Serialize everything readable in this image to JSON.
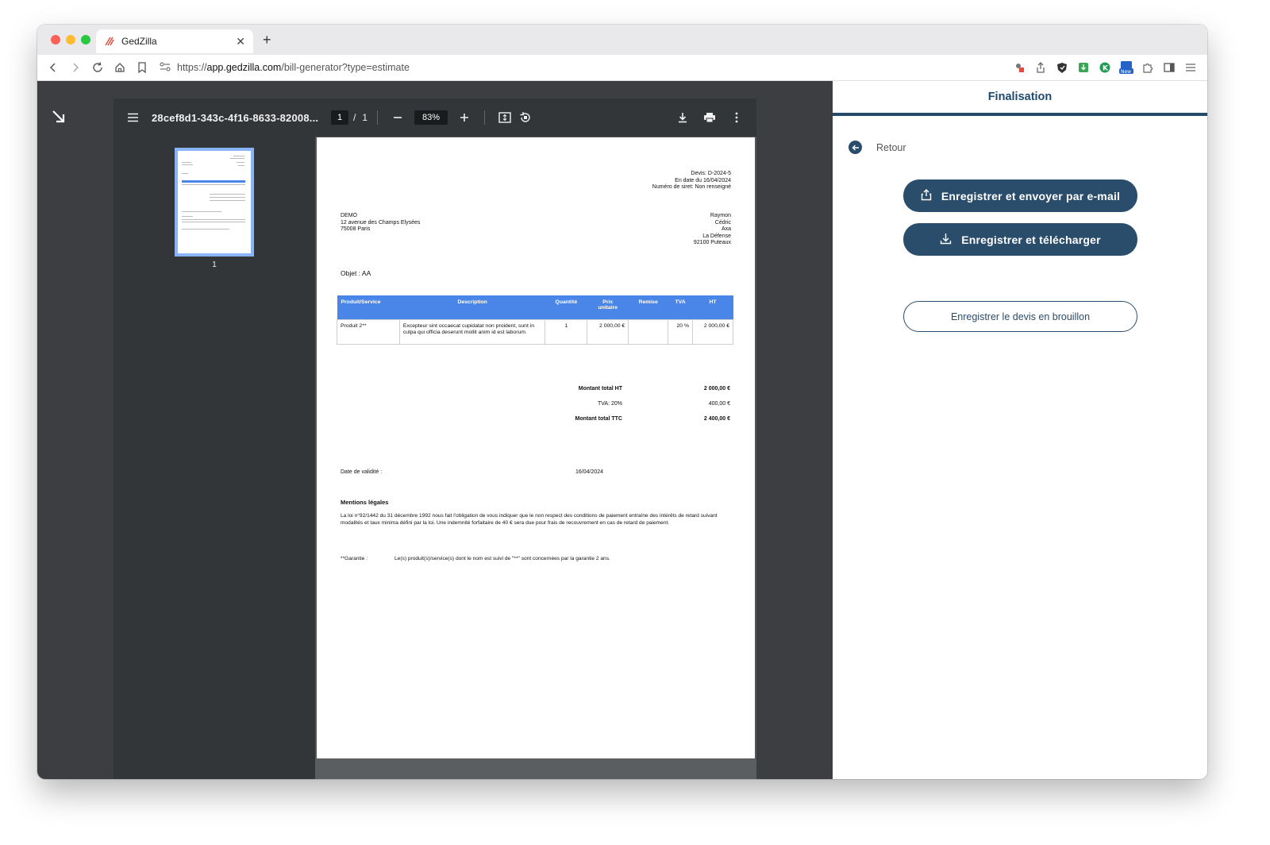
{
  "browser": {
    "tab_title": "GedZilla",
    "tab_close": "✕",
    "new_tab": "+",
    "url_scheme": "https://",
    "url_host": "app.gedzilla.com",
    "url_path": "/bill-generator?type=estimate"
  },
  "pdf_viewer": {
    "file_name": "28cef8d1-343c-4f16-8633-82008...",
    "current_page": "1",
    "page_separator": "/",
    "total_pages": "1",
    "zoom": "83%",
    "thumbnail_label": "1"
  },
  "document": {
    "devis_number": "Devis: D-2024-5",
    "date_line": "En date du 16/04/2024",
    "siret_line": "Numéro de siret: Non renseigné",
    "sender": {
      "name": "DEMO",
      "address": "12 avenue des Champs Elysées",
      "city": "75008 Paris"
    },
    "recipient": {
      "line1": "Raymon",
      "line2": "Cédric",
      "line3": "Axa",
      "line4": "La Défense",
      "line5": "92100 Puteaux"
    },
    "objet": "Objet : AA",
    "table": {
      "headers": {
        "product": "Produit/Service",
        "description": "Description",
        "quantity": "Quantité",
        "unit_price_1": "Prix",
        "unit_price_2": "unitaire",
        "discount": "Remise",
        "tva": "TVA",
        "ht": "HT"
      },
      "rows": [
        {
          "product": "Produit 2**",
          "description": "Excepteur sint occaecat cupidatat non proident, sunt in culpa qui officia deserunt mollit anim id est laborum.",
          "quantity": "1",
          "unit_price": "2 000,00 €",
          "discount": "",
          "tva": "20 %",
          "ht": "2 000,00 €"
        }
      ]
    },
    "totals": {
      "ht_label": "Montant total HT",
      "ht_value": "2 000,00 €",
      "tva_label": "TVA: 20%",
      "tva_value": "400,00 €",
      "ttc_label": "Montant total TTC",
      "ttc_value": "2 400,00 €"
    },
    "validite_label": "Date de validité :",
    "validite_value": "16/04/2024",
    "mentions_title": "Mentions légales",
    "mentions_text": "La loi n°92/1442 du 31 décembre 1992 nous fait l'obligation de vous indiquer que le non respect des conditions de paiement entraîne des intérêts de retard suivant modalités et taux minima défini par la loi. Une indemnité forfaitaire de 40 € sera due pour frais de recouvrement en cas de retard de paiement.",
    "garantie_label": "**Garantie :",
    "garantie_text": "Le(s) produit(s)/service(s) dont le nom est suivi de \"**\" sont concernées par la garantie 2 ans."
  },
  "panel": {
    "title": "Finalisation",
    "back_label": "Retour",
    "send_button": "Enregistrer et envoyer par e-mail",
    "download_button": "Enregistrer et télécharger",
    "draft_button": "Enregistrer le devis en brouillon"
  },
  "colors": {
    "primary": "#2b4d6c",
    "table_header": "#4a86e8",
    "thumb_border": "#8ab4f8"
  }
}
